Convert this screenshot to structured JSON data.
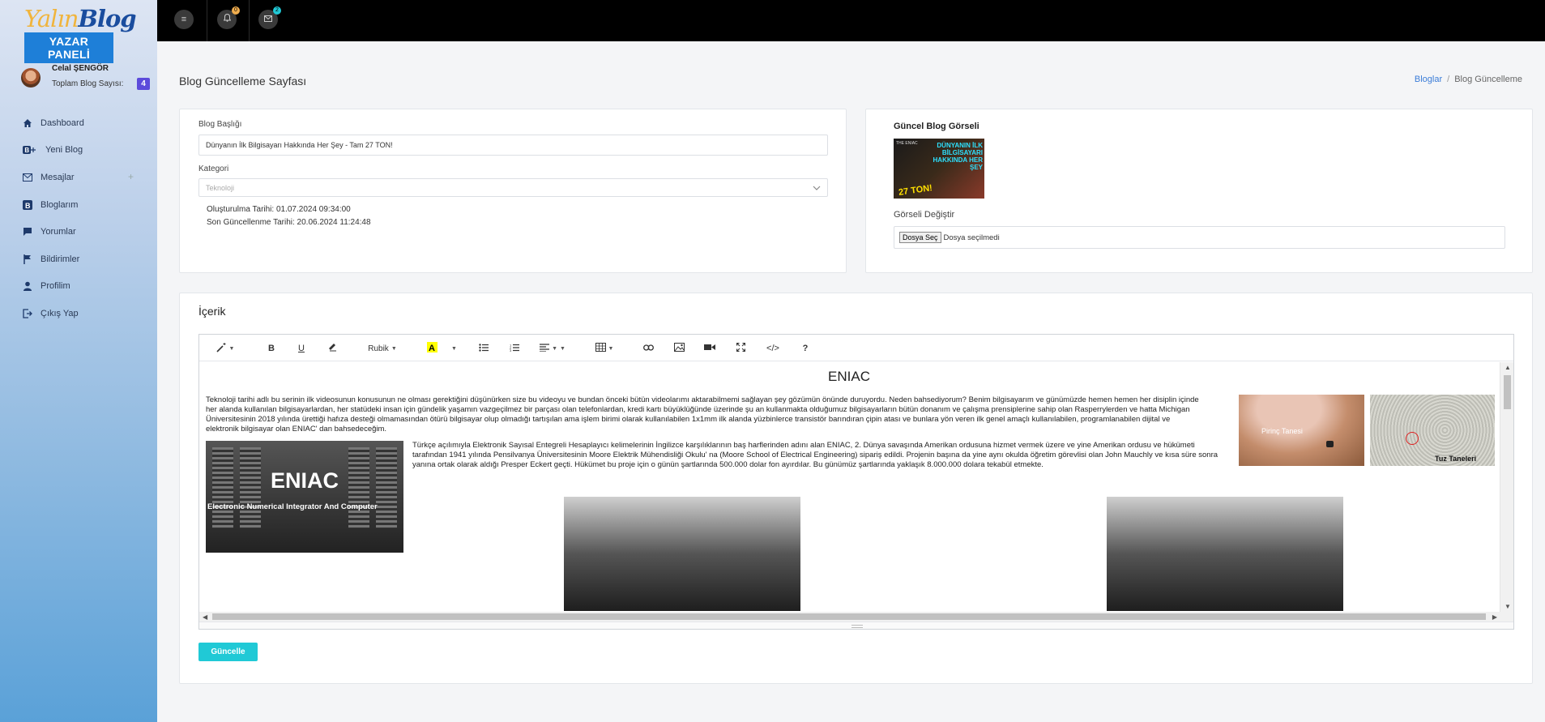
{
  "sidebar": {
    "logo_main": "Yalın",
    "logo_blog": "Blog",
    "panel_label": "YAZAR PANELİ",
    "user_name": "Celal ŞENGÖR",
    "blog_count_label": "Toplam Blog Sayısı:",
    "blog_count": "4",
    "items": [
      {
        "label": "Dashboard",
        "icon": "home-icon"
      },
      {
        "label": "Yeni Blog",
        "icon": "blogger-plus-icon"
      },
      {
        "label": "Mesajlar",
        "icon": "envelope-icon"
      },
      {
        "label": "Bloglarım",
        "icon": "blogger-icon"
      },
      {
        "label": "Yorumlar",
        "icon": "comment-icon"
      },
      {
        "label": "Bildirimler",
        "icon": "flag-icon"
      },
      {
        "label": "Profilim",
        "icon": "user-icon"
      },
      {
        "label": "Çıkış Yap",
        "icon": "logout-icon"
      }
    ]
  },
  "topbar": {
    "notif_count": "0",
    "mail_count": "2",
    "notif_color": "#f0ad4e",
    "mail_color": "#20c9d6"
  },
  "header": {
    "title": "Blog Güncelleme Sayfası",
    "breadcrumb_root": "Bloglar",
    "breadcrumb_current": "Blog Güncelleme"
  },
  "form": {
    "title_label": "Blog Başlığı",
    "title_value": "Dünyanın İlk Bilgisayarı Hakkında Her Şey - Tam 27 TON!",
    "category_label": "Kategori",
    "category_value": "Teknoloji",
    "created_label": "Oluşturulma Tarihi:",
    "created_value": "01.07.2024 09:34:00",
    "updated_label": "Son Güncellenme Tarihi:",
    "updated_value": "20.06.2024 11:24:48"
  },
  "image_card": {
    "current_label": "Güncel Blog Görseli",
    "thumb_text": "DÜNYANIN İLK BİLGİSAYARI HAKKINDA HER ŞEY",
    "thumb_badge": "27 TON!",
    "thumb_small": "THE ENIAC",
    "change_label": "Görseli Değiştir",
    "file_button": "Dosya Seç",
    "file_status": "Dosya seçilmedi"
  },
  "content": {
    "section_title": "İçerik",
    "font_name": "Rubik",
    "doc_title": "ENIAC",
    "para1": "Teknoloji tarihi adlı bu serinin ilk videosunun konusunun ne olması gerektiğini düşünürken size bu videoyu ve bundan önceki bütün videolarımı aktarabilmemi sağlayan şey gözümün önünde duruyordu. Neden bahsediyorum? Benim bilgisayarım ve günümüzde hemen hemen her disiplin içinde her alanda kullanılan bilgisayarlardan, her statüdeki insan için gündelik yaşamın vazgeçilmez bir parçası olan telefonlardan, kredi kartı büyüklüğünde üzerinde şu an kullanmakta olduğumuz bilgisayarların bütün donanım ve çalışma prensiplerine sahip olan Rasperrylerden ve hatta Michigan Üniversitesinin 2018 yılında ürettiği hafıza desteği olmamasından ötürü bilgisayar olup olmadığı tartışılan ama işlem birimi olarak kullanılabilen 1x1mm ilk alanda yüzbinlerce transistör barındıran çipin atası ve bunlara yön veren ilk genel amaçlı kullanılabilen, programlanabilen dijital ve elektronik bilgisayar olan ENIAC' dan bahsedeceğim.",
    "para2": "Türkçe açılımıyla Elektronik Sayısal Entegreli Hesaplayıcı kelimelerinin İngilizce karşılıklarının baş harflerinden adını alan ENIAC, 2. Dünya savaşında Amerikan ordusuna hizmet vermek üzere ve yine Amerikan ordusu ve hükümeti tarafından 1941 yılında Pensilvanya Üniversitesinin Moore Elektrik Mühendisliği Okulu' na (Moore School of Electrical Engineering) sipariş edildi. Projenin başına da yine aynı okulda öğretim görevlisi olan John Mauchly ve kısa süre sonra yanına ortak olarak aldığı Presper Eckert geçti. Hükümet bu proje için o günün şartlarında 500.000 dolar fon ayırdılar. Bu günümüz şartlarında yaklaşık 8.000.000 dolara tekabül etmekte.",
    "eniac_img_title": "ENIAC",
    "eniac_img_sub": "Electronic Numerical Integrator And Computer",
    "rice_caption": "Pirinç Tanesi",
    "salt_caption": "Tuz Taneleri",
    "submit": "Güncelle"
  }
}
